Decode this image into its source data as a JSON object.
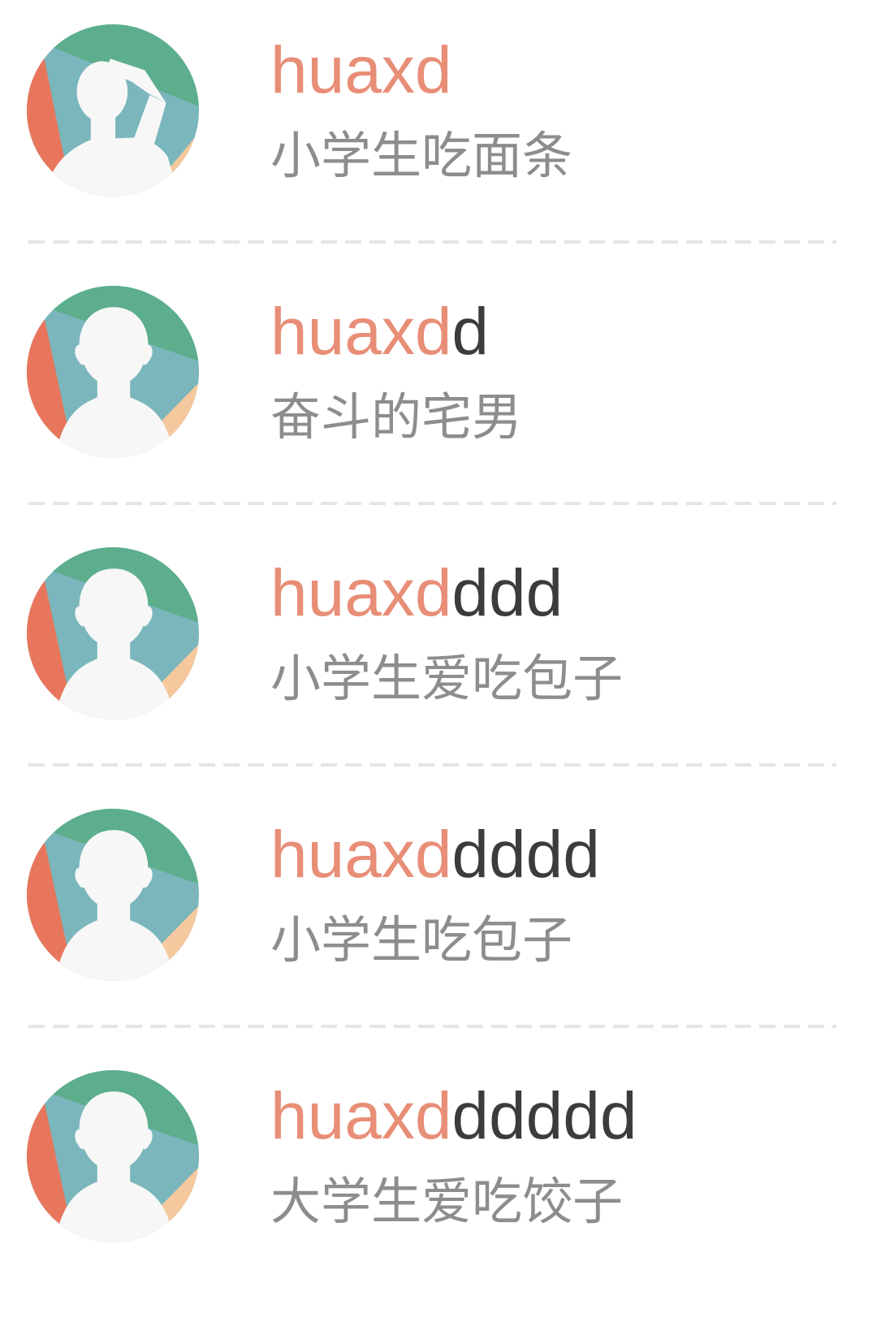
{
  "colors": {
    "highlight": "#e88e77",
    "name": "#3c3c3c",
    "subtitle": "#8d8d8d",
    "divider": "#e5e5e5",
    "avatar_teal": "#7ab6bb",
    "avatar_green": "#5cae8d",
    "avatar_red": "#e8765c",
    "avatar_peach": "#f6c89d",
    "avatar_silhouette": "#f7f7f7"
  },
  "users": [
    {
      "avatar_icon": "salute-silhouette-icon",
      "name_highlight": "huaxd",
      "name_rest": "",
      "subtitle": "小学生吃面条"
    },
    {
      "avatar_icon": "person-silhouette-icon",
      "name_highlight": "huaxd",
      "name_rest": "d",
      "subtitle": "奋斗的宅男"
    },
    {
      "avatar_icon": "person-silhouette-icon",
      "name_highlight": "huaxd",
      "name_rest": "ddd",
      "subtitle": "小学生爱吃包子"
    },
    {
      "avatar_icon": "person-silhouette-icon",
      "name_highlight": "huaxd",
      "name_rest": "dddd",
      "subtitle": "小学生吃包子"
    },
    {
      "avatar_icon": "person-silhouette-icon",
      "name_highlight": "huaxd",
      "name_rest": "ddddd",
      "subtitle": "大学生爱吃饺子"
    }
  ]
}
